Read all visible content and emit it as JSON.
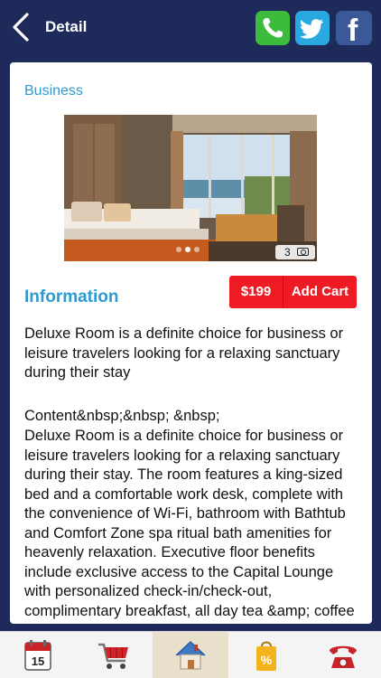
{
  "header": {
    "title": "Detail"
  },
  "detail": {
    "category": "Business",
    "photo_count": "3",
    "info_heading": "Information",
    "price": "$199",
    "add_cart": "Add Cart",
    "summary": "Deluxe Room is a definite choice for business or leisure travelers looking for a relaxing sanctuary during their stay",
    "content_label": "Content&nbsp;&nbsp; &nbsp;",
    "content_body": "Deluxe Room is a definite choice for business or leisure travelers looking for a relaxing sanctuary during their stay. The room features a king-sized bed and a comfortable work desk, complete with the convenience of Wi-Fi, bathroom with Bathtub and Comfort Zone spa ritual bath amenities for heavenly relaxation. Executive floor benefits include exclusive access to the Capital Lounge with personalized check-in/check-out, complimentary breakfast, all day tea &amp; coffee and evening cocktails."
  },
  "calendar_day": "15",
  "icons": [
    "back-arrow-icon",
    "phone-icon",
    "twitter-icon",
    "facebook-icon",
    "calendar-icon",
    "shopping-cart-icon",
    "home-icon",
    "discount-bag-icon",
    "telephone-icon",
    "camera-icon"
  ],
  "colors": {
    "nav_bg": "#1e2a5a",
    "accent_blue": "#2e9ad0",
    "price_red": "#ee1b24",
    "phone_green": "#3dbb3d",
    "twitter_blue": "#2aa9e0",
    "facebook_blue": "#3b5998"
  }
}
